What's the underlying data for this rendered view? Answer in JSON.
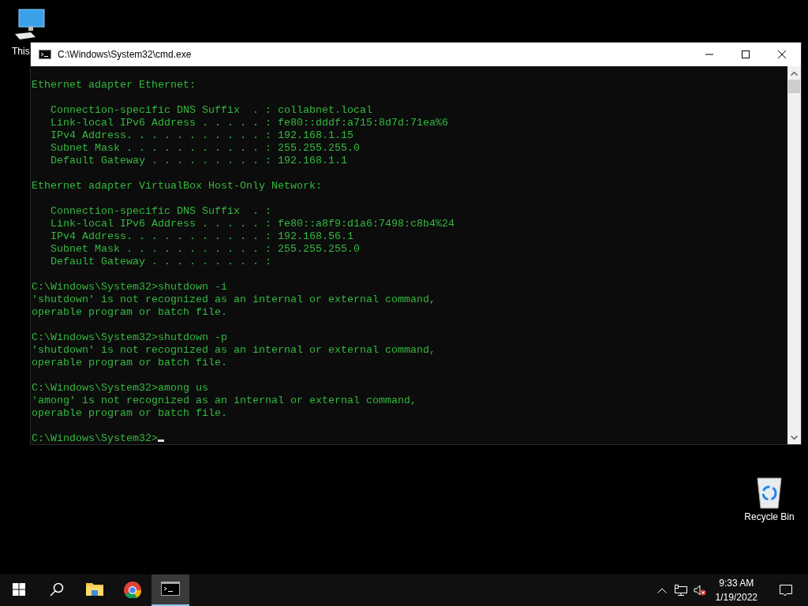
{
  "desktop_icons": [
    {
      "kind": "computer",
      "label": "This"
    },
    {
      "kind": "recycle",
      "label": "Recycle Bin"
    }
  ],
  "window": {
    "title": "C:\\Windows\\System32\\cmd.exe",
    "console": [
      [
        "Ethernet adapter Ethernet:"
      ],
      [
        "   Connection-specific DNS Suffix  . : collabnet.local",
        "   Link-local IPv6 Address . . . . . : fe80::dddf:a715:8d7d:71ea%6",
        "   IPv4 Address. . . . . . . . . . . : 192.168.1.15",
        "   Subnet Mask . . . . . . . . . . . : 255.255.255.0",
        "   Default Gateway . . . . . . . . . : 192.168.1.1"
      ],
      [
        "Ethernet adapter VirtualBox Host-Only Network:"
      ],
      [
        "   Connection-specific DNS Suffix  . :",
        "   Link-local IPv6 Address . . . . . : fe80::a8f9:d1a6:7498:c8b4%24",
        "   IPv4 Address. . . . . . . . . . . : 192.168.56.1",
        "   Subnet Mask . . . . . . . . . . . : 255.255.255.0",
        "   Default Gateway . . . . . . . . . :"
      ],
      [
        "C:\\Windows\\System32>shutdown -i",
        "'shutdown' is not recognized as an internal or external command,",
        "operable program or batch file."
      ],
      [
        "C:\\Windows\\System32>shutdown -p",
        "'shutdown' is not recognized as an internal or external command,",
        "operable program or batch file."
      ],
      [
        "C:\\Windows\\System32>among us",
        "'among' is not recognized as an internal or external command,",
        "operable program or batch file."
      ]
    ],
    "prompt": {
      "text": "C:\\Windows\\System32>",
      "cursor": true
    }
  },
  "taskbar": {
    "apps": [
      {
        "kind": "folder",
        "selected": false
      },
      {
        "kind": "browser",
        "selected": false
      },
      {
        "kind": "terminal",
        "selected": true
      }
    ],
    "clock": {
      "time": "9:33 AM",
      "date": "1/19/2022"
    }
  }
}
